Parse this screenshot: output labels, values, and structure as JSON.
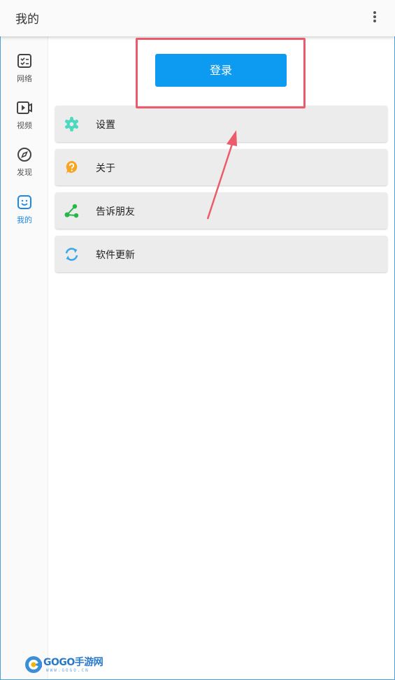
{
  "appbar": {
    "title": "我的",
    "more_icon": "more-vert-icon"
  },
  "sidebar": {
    "items": [
      {
        "label": "网络",
        "icon": "network-list-icon",
        "active": false
      },
      {
        "label": "视频",
        "icon": "video-icon",
        "active": false
      },
      {
        "label": "发现",
        "icon": "compass-icon",
        "active": false
      },
      {
        "label": "我的",
        "icon": "smiley-face-icon",
        "active": true
      }
    ],
    "active_color": "#1e88e5"
  },
  "main": {
    "login_label": "登录",
    "login_color": "#0d9bf2",
    "menu": [
      {
        "label": "设置",
        "icon": "settings-gear-icon",
        "color": "#4dd9c0"
      },
      {
        "label": "关于",
        "icon": "question-icon",
        "color": "#f6a623"
      },
      {
        "label": "告诉朋友",
        "icon": "share-icon",
        "color": "#27b64a"
      },
      {
        "label": "软件更新",
        "icon": "refresh-icon",
        "color": "#3aa7e8"
      }
    ]
  },
  "annotation": {
    "color": "#ec5b6b"
  },
  "watermark": {
    "text": "GOGO手游网",
    "sub": "WWW.GOGO.CN"
  }
}
